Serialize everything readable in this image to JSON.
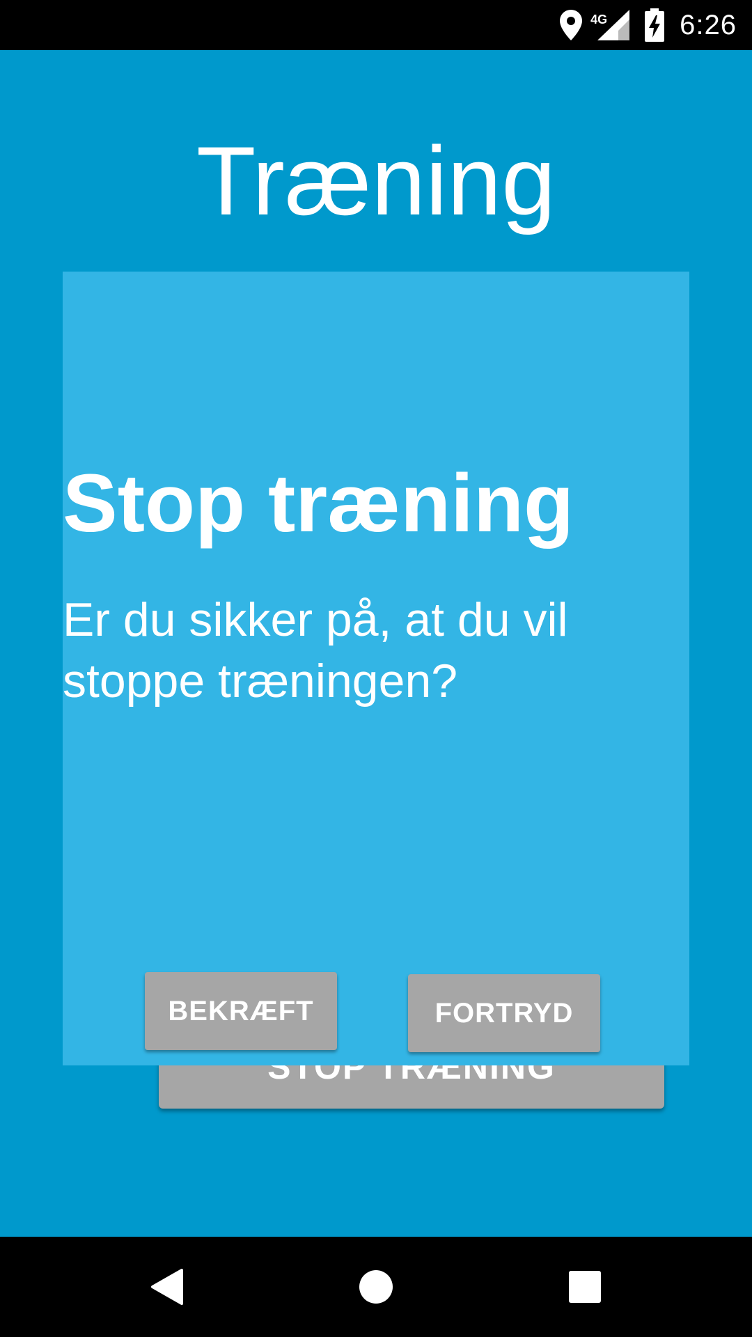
{
  "status_bar": {
    "time": "6:26",
    "network_label": "4G",
    "icons": [
      "location-icon",
      "signal-icon",
      "battery-charging-icon"
    ]
  },
  "page": {
    "title": "Træning",
    "background_button_label": "STOP TRÆNING"
  },
  "dialog": {
    "title": "Stop træning",
    "message": "Er du sikker på, at du vil stoppe træningen?",
    "confirm_label": "BEKRÆFT",
    "cancel_label": "FORTRYD"
  },
  "nav_bar": {
    "icons": [
      "back-icon",
      "home-icon",
      "recents-icon"
    ]
  },
  "colors": {
    "background": "#0099cc",
    "dialog": "#33b5e5",
    "button": "#a6a6a6",
    "bars": "#000000"
  }
}
